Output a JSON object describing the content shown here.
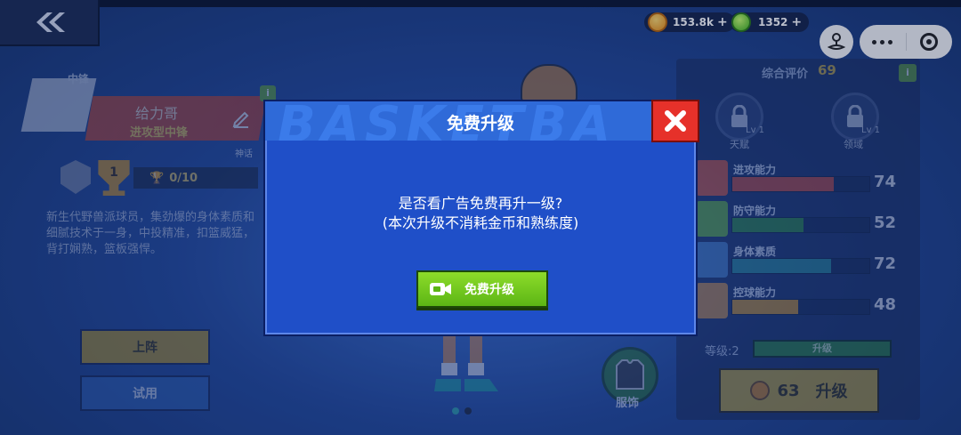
{
  "header": {
    "coins": "153.8k",
    "gems": "1352",
    "plus_symbol": "+"
  },
  "player": {
    "position": "中锋",
    "name": "给力哥",
    "type": "进攻型中锋",
    "rarity": "神话",
    "rank": "1",
    "trophy_progress": "0/10",
    "description": "新生代野兽派球员，集劲爆的身体素质和细腻技术于一身，中投精准，扣篮威猛，背打娴熟，篮板强悍。"
  },
  "buttons": {
    "promote": "上阵",
    "trial": "试用"
  },
  "right_panel": {
    "rating_label": "综合评价",
    "rating_value": "69",
    "talent": {
      "label": "天赋",
      "level": "Lv 1"
    },
    "domain": {
      "label": "领域",
      "level": "Lv 1"
    },
    "stats": [
      {
        "name": "进攻能力",
        "value": "74",
        "fill": 0.74,
        "color": "#d7482c",
        "icon_color": "#e8562e"
      },
      {
        "name": "防守能力",
        "value": "52",
        "fill": 0.52,
        "color": "#2f8f32",
        "icon_color": "#6ab82e"
      },
      {
        "name": "身体素质",
        "value": "72",
        "fill": 0.72,
        "color": "#2a8f93",
        "icon_color": "#4a82c8"
      },
      {
        "name": "控球能力",
        "value": "48",
        "fill": 0.48,
        "color": "#e09a1c",
        "icon_color": "#d9923a"
      }
    ],
    "level_label": "等级:2",
    "level_bar_label": "升级",
    "upgrade_cost": "63",
    "upgrade_label": "升级"
  },
  "scene": {
    "outfit_number": "1",
    "outfit_label": "服饰"
  },
  "dialog": {
    "title": "免费升级",
    "message_line1": "是否看广告免费再升一级?",
    "message_line2": "(本次升级不消耗金币和熟练度)",
    "button_label": "免费升级",
    "header_watermark": "BASKETBA"
  },
  "colors": {
    "dialog_bg": "#1f4fc8",
    "close_red": "#e6312a",
    "button_green": "#6cc51c"
  }
}
